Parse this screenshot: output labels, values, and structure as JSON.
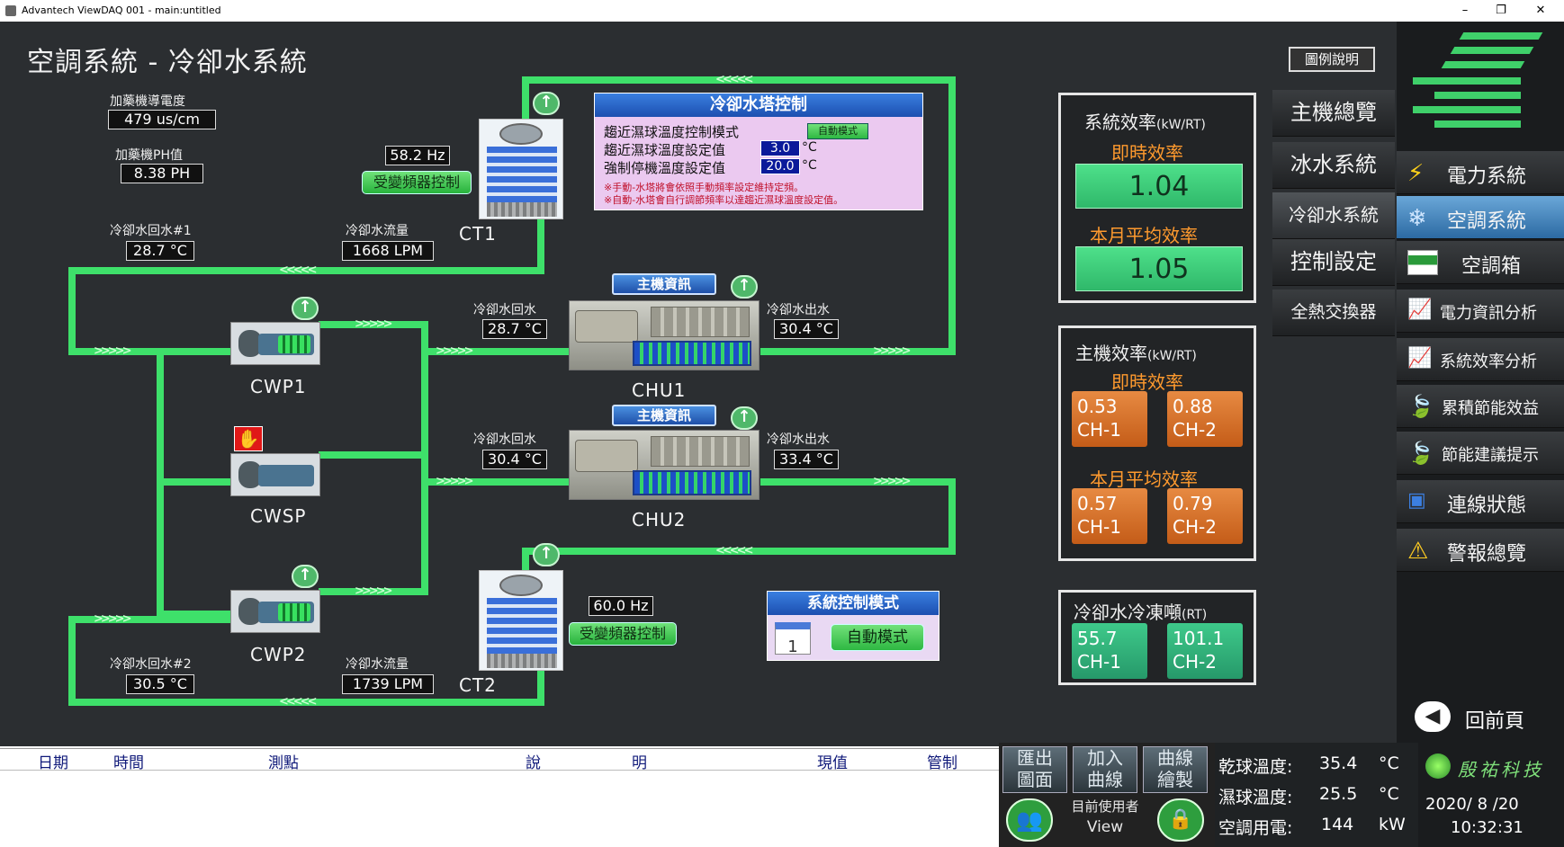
{
  "window": {
    "title": "Advantech ViewDAQ 001 - main:untitled",
    "min": "–",
    "max": "❐",
    "close": "✕"
  },
  "page_title": "空調系統 - 冷卻水系統",
  "legend_button": "圖例說明",
  "additive": {
    "conductivity_label": "加藥機導電度",
    "conductivity_value": "479 us/cm",
    "ph_label": "加藥機PH值",
    "ph_value": "8.38 PH"
  },
  "loop1": {
    "return_label": "冷卻水回水#1",
    "return_value": "28.7 °C",
    "flow_label": "冷卻水流量",
    "flow_value": "1668 LPM"
  },
  "loop2": {
    "return_label": "冷卻水回水#2",
    "return_value": "30.5 °C",
    "flow_label": "冷卻水流量",
    "flow_value": "1739 LPM"
  },
  "ct1": {
    "name": "CT1",
    "hz": "58.2 Hz",
    "vfd_button": "受變頻器控制"
  },
  "ct2": {
    "name": "CT2",
    "hz": "60.0 Hz",
    "vfd_button": "受變頻器控制"
  },
  "pumps": {
    "cwp1": "CWP1",
    "cwsp": "CWSP",
    "cwp2": "CWP2"
  },
  "chu1": {
    "name": "CHU1",
    "info_button": "主機資訊",
    "in_label": "冷卻水回水",
    "in_value": "28.7 °C",
    "out_label": "冷卻水出水",
    "out_value": "30.4 °C"
  },
  "chu2": {
    "name": "CHU2",
    "info_button": "主機資訊",
    "in_label": "冷卻水回水",
    "in_value": "30.4 °C",
    "out_label": "冷卻水出水",
    "out_value": "33.4 °C"
  },
  "tower_ctrl": {
    "title": "冷卻水塔控制",
    "mode_label": "趨近濕球溫度控制模式",
    "mode_value": "自動模式",
    "approach_label": "趨近濕球溫度設定值",
    "approach_value": "3.0",
    "approach_unit": "°C",
    "stop_label": "強制停機溫度設定值",
    "stop_value": "20.0",
    "stop_unit": "°C",
    "note1": "※手動-水塔將會依照手動頻率設定維持定頻。",
    "note2": "※自動-水塔會自行調節頻率以達趨近濕球溫度設定值。"
  },
  "sys_ctrl": {
    "title": "系統控制模式",
    "button": "自動模式",
    "calendar": "1"
  },
  "sys_eff": {
    "title": "系統效率",
    "unit": "(kW/RT)",
    "now_label": "即時效率",
    "now_value": "1.04",
    "month_label": "本月平均效率",
    "month_value": "1.05"
  },
  "chiller_eff": {
    "title": "主機效率",
    "unit": "(kW/RT)",
    "now_label": "即時效率",
    "month_label": "本月平均效率",
    "now": [
      {
        "value": "0.53",
        "name": "CH-1"
      },
      {
        "value": "0.88",
        "name": "CH-2"
      }
    ],
    "month": [
      {
        "value": "0.57",
        "name": "CH-1"
      },
      {
        "value": "0.79",
        "name": "CH-2"
      }
    ]
  },
  "tonnage": {
    "title": "冷卻水冷凍噸",
    "unit": "(RT)",
    "items": [
      {
        "value": "55.7",
        "name": "CH-1"
      },
      {
        "value": "101.1",
        "name": "CH-2"
      }
    ]
  },
  "subnav": [
    "主機總覽",
    "冰水系統",
    "冷卻水系統",
    "控制設定",
    "全熱交換器"
  ],
  "nav": [
    "電力系統",
    "空調系統",
    "空調箱",
    "電力資訊分析",
    "系統效率分析",
    "累積節能效益",
    "節能建議提示",
    "連線狀態",
    "警報總覽"
  ],
  "back": "回前頁",
  "alarm_table": {
    "headers": [
      "日期",
      "時間",
      "測點",
      "說",
      "明",
      "現值",
      "管制"
    ]
  },
  "bottom_buttons": {
    "export": [
      "匯出",
      "圖面"
    ],
    "add_curve": [
      "加入",
      "曲線"
    ],
    "draw_curve": [
      "曲線",
      "繪製"
    ],
    "user_label": "目前使用者",
    "user": "View"
  },
  "env": {
    "dry_label": "乾球溫度:",
    "dry_value": "35.4",
    "dry_unit": "°C",
    "wet_label": "濕球溫度:",
    "wet_value": "25.5",
    "wet_unit": "°C",
    "power_label": "空調用電:",
    "power_value": "144",
    "power_unit": "kW"
  },
  "brand": {
    "name": "殷祐科技",
    "date": "2020/ 8 /20",
    "time": "10:32:31"
  },
  "colors": {
    "pipe": "#3ee06a",
    "accent_orange": "#ff9a2e",
    "panel_bg": "#222426"
  }
}
